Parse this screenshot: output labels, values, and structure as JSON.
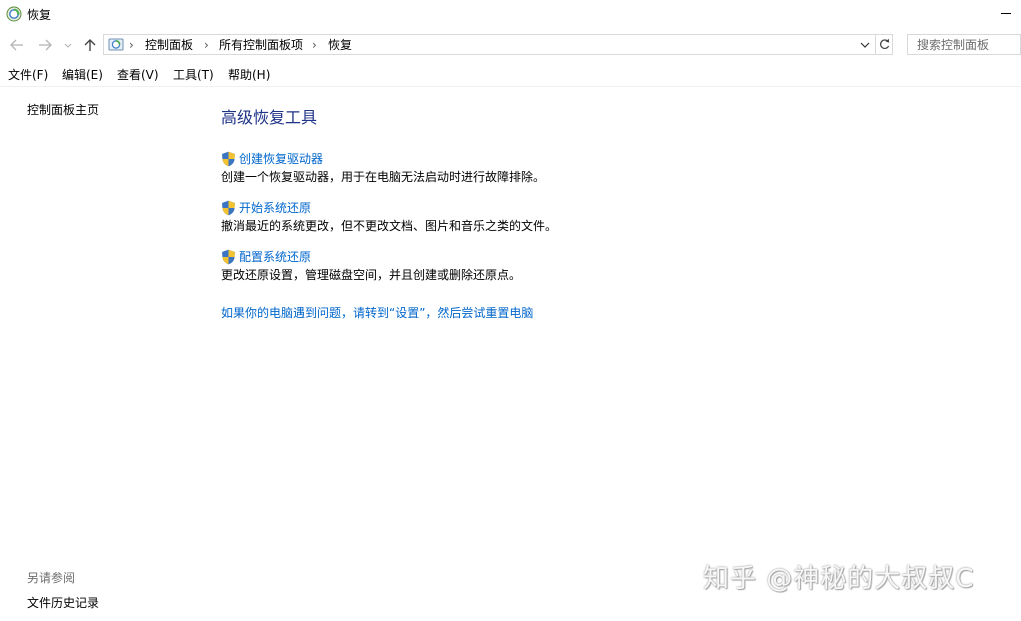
{
  "window": {
    "title": "恢复"
  },
  "address": {
    "crumbs": [
      "控制面板",
      "所有控制面板项",
      "恢复"
    ],
    "separator": "›",
    "refresh_symbol": "↻"
  },
  "search": {
    "placeholder": "搜索控制面板"
  },
  "menu": {
    "items": [
      "文件(F)",
      "编辑(E)",
      "查看(V)",
      "工具(T)",
      "帮助(H)"
    ]
  },
  "sidebar": {
    "home_link": "控制面板主页",
    "see_also_heading": "另请参阅",
    "see_also_links": [
      "文件历史记录"
    ]
  },
  "main": {
    "title": "高级恢复工具",
    "tasks": [
      {
        "label": "创建恢复驱动器",
        "description": "创建一个恢复驱动器，用于在电脑无法启动时进行故障排除。"
      },
      {
        "label": "开始系统还原",
        "description": "撤消最近的系统更改，但不更改文档、图片和音乐之类的文件。"
      },
      {
        "label": "配置系统还原",
        "description": "更改还原设置，管理磁盘空间，并且创建或删除还原点。"
      }
    ],
    "reset_link": "如果你的电脑遇到问题，请转到“设置”，然后尝试重置电脑"
  },
  "watermark": {
    "text": "知乎 @神秘的大叔叔C"
  },
  "colors": {
    "link": "#0066cc",
    "title": "#1e3287",
    "muted": "#6d6d6d",
    "border": "#d9d9d9"
  },
  "icons": {
    "window": "recovery-icon",
    "back": "back-arrow-icon",
    "forward": "forward-arrow-icon",
    "recent": "chevron-down-icon",
    "up": "up-arrow-icon",
    "task": "uac-shield-icon"
  }
}
